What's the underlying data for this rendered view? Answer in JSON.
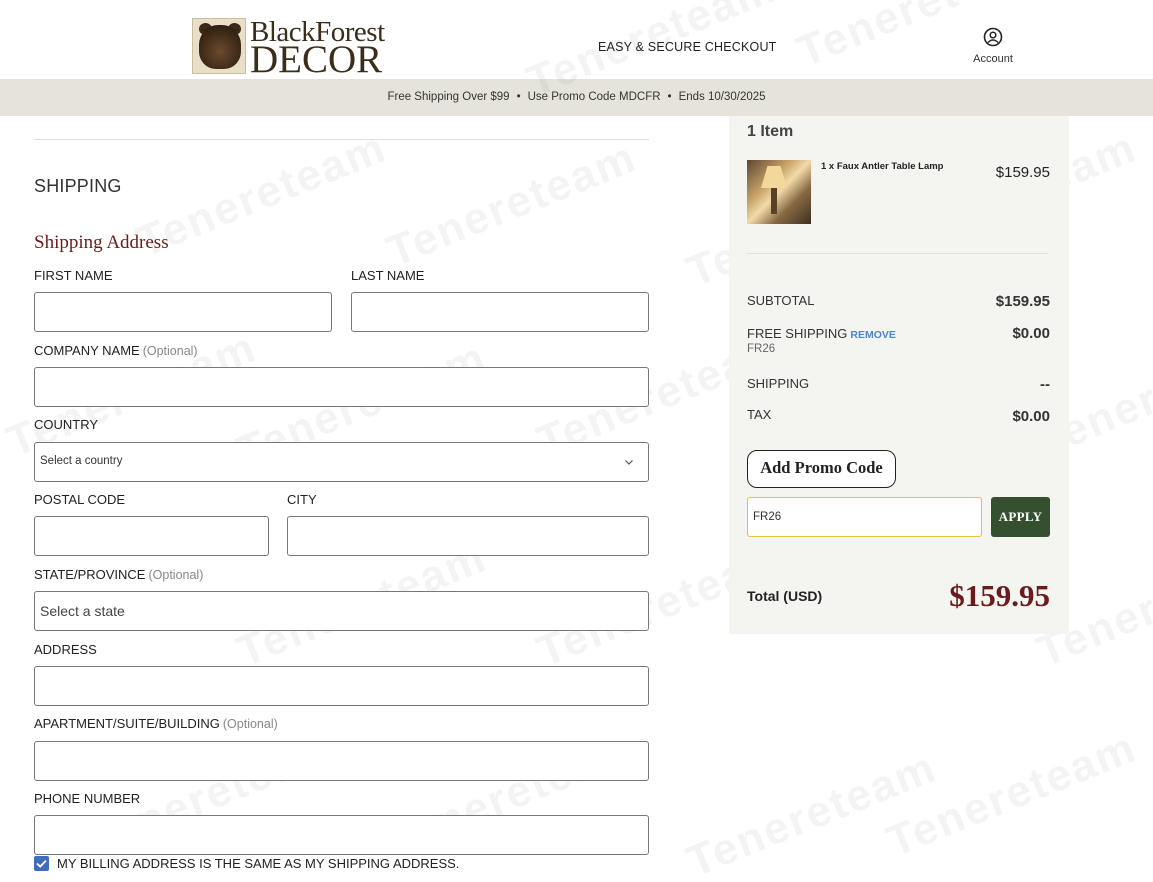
{
  "header": {
    "logo_line1": "BlackForest",
    "logo_line2": "DECOR",
    "checkout_title": "EASY & SECURE CHECKOUT",
    "account_label": "Account",
    "account_icon": "user-circle-icon"
  },
  "promo_bar": {
    "item1": "Free Shipping Over $99",
    "item2": "Use Promo Code MDCFR",
    "item3": "Ends 10/30/2025",
    "separator": "•"
  },
  "form": {
    "section_title": "SHIPPING",
    "sub_title": "Shipping Address",
    "first_name": {
      "label": "FIRST NAME",
      "value": ""
    },
    "last_name": {
      "label": "LAST NAME",
      "value": ""
    },
    "company": {
      "label": "COMPANY NAME",
      "optional": "(Optional)",
      "value": ""
    },
    "country": {
      "label": "COUNTRY",
      "selected": "Select a country"
    },
    "postal": {
      "label": "POSTAL CODE",
      "value": ""
    },
    "city": {
      "label": "CITY",
      "value": ""
    },
    "state": {
      "label": "STATE/PROVINCE",
      "optional": "(Optional)",
      "selected": "Select a state"
    },
    "address": {
      "label": "ADDRESS",
      "value": ""
    },
    "apartment": {
      "label": "APARTMENT/SUITE/BUILDING",
      "optional": "(Optional)",
      "value": ""
    },
    "phone": {
      "label": "PHONE NUMBER",
      "value": ""
    },
    "billing_same": {
      "label": "MY BILLING ADDRESS IS THE SAME AS MY SHIPPING ADDRESS.",
      "checked": true
    }
  },
  "summary": {
    "items_count": "1 Item",
    "product": {
      "name": "1 x Faux Antler Table Lamp",
      "price": "$159.95"
    },
    "subtotal": {
      "label": "SUBTOTAL",
      "value": "$159.95"
    },
    "free_shipping": {
      "label": "FREE SHIPPING",
      "remove": "REMOVE",
      "code": "FR26",
      "value": "$0.00"
    },
    "shipping": {
      "label": "SHIPPING",
      "value": "--"
    },
    "tax": {
      "label": "TAX",
      "value": "$0.00"
    },
    "add_promo_label": "Add Promo Code",
    "promo_value": "FR26",
    "apply_label": "APPLY",
    "total": {
      "label": "Total (USD)",
      "value": "$159.95"
    }
  },
  "colors": {
    "accent_red": "#6b1b1b",
    "apply_green": "#34502e",
    "promo_bar_bg": "#e6e4da",
    "summary_bg": "#f4f4f1",
    "link_blue": "#4c87c6",
    "checkbox_blue": "#3f6dbd"
  },
  "watermark": "Tenereteam"
}
